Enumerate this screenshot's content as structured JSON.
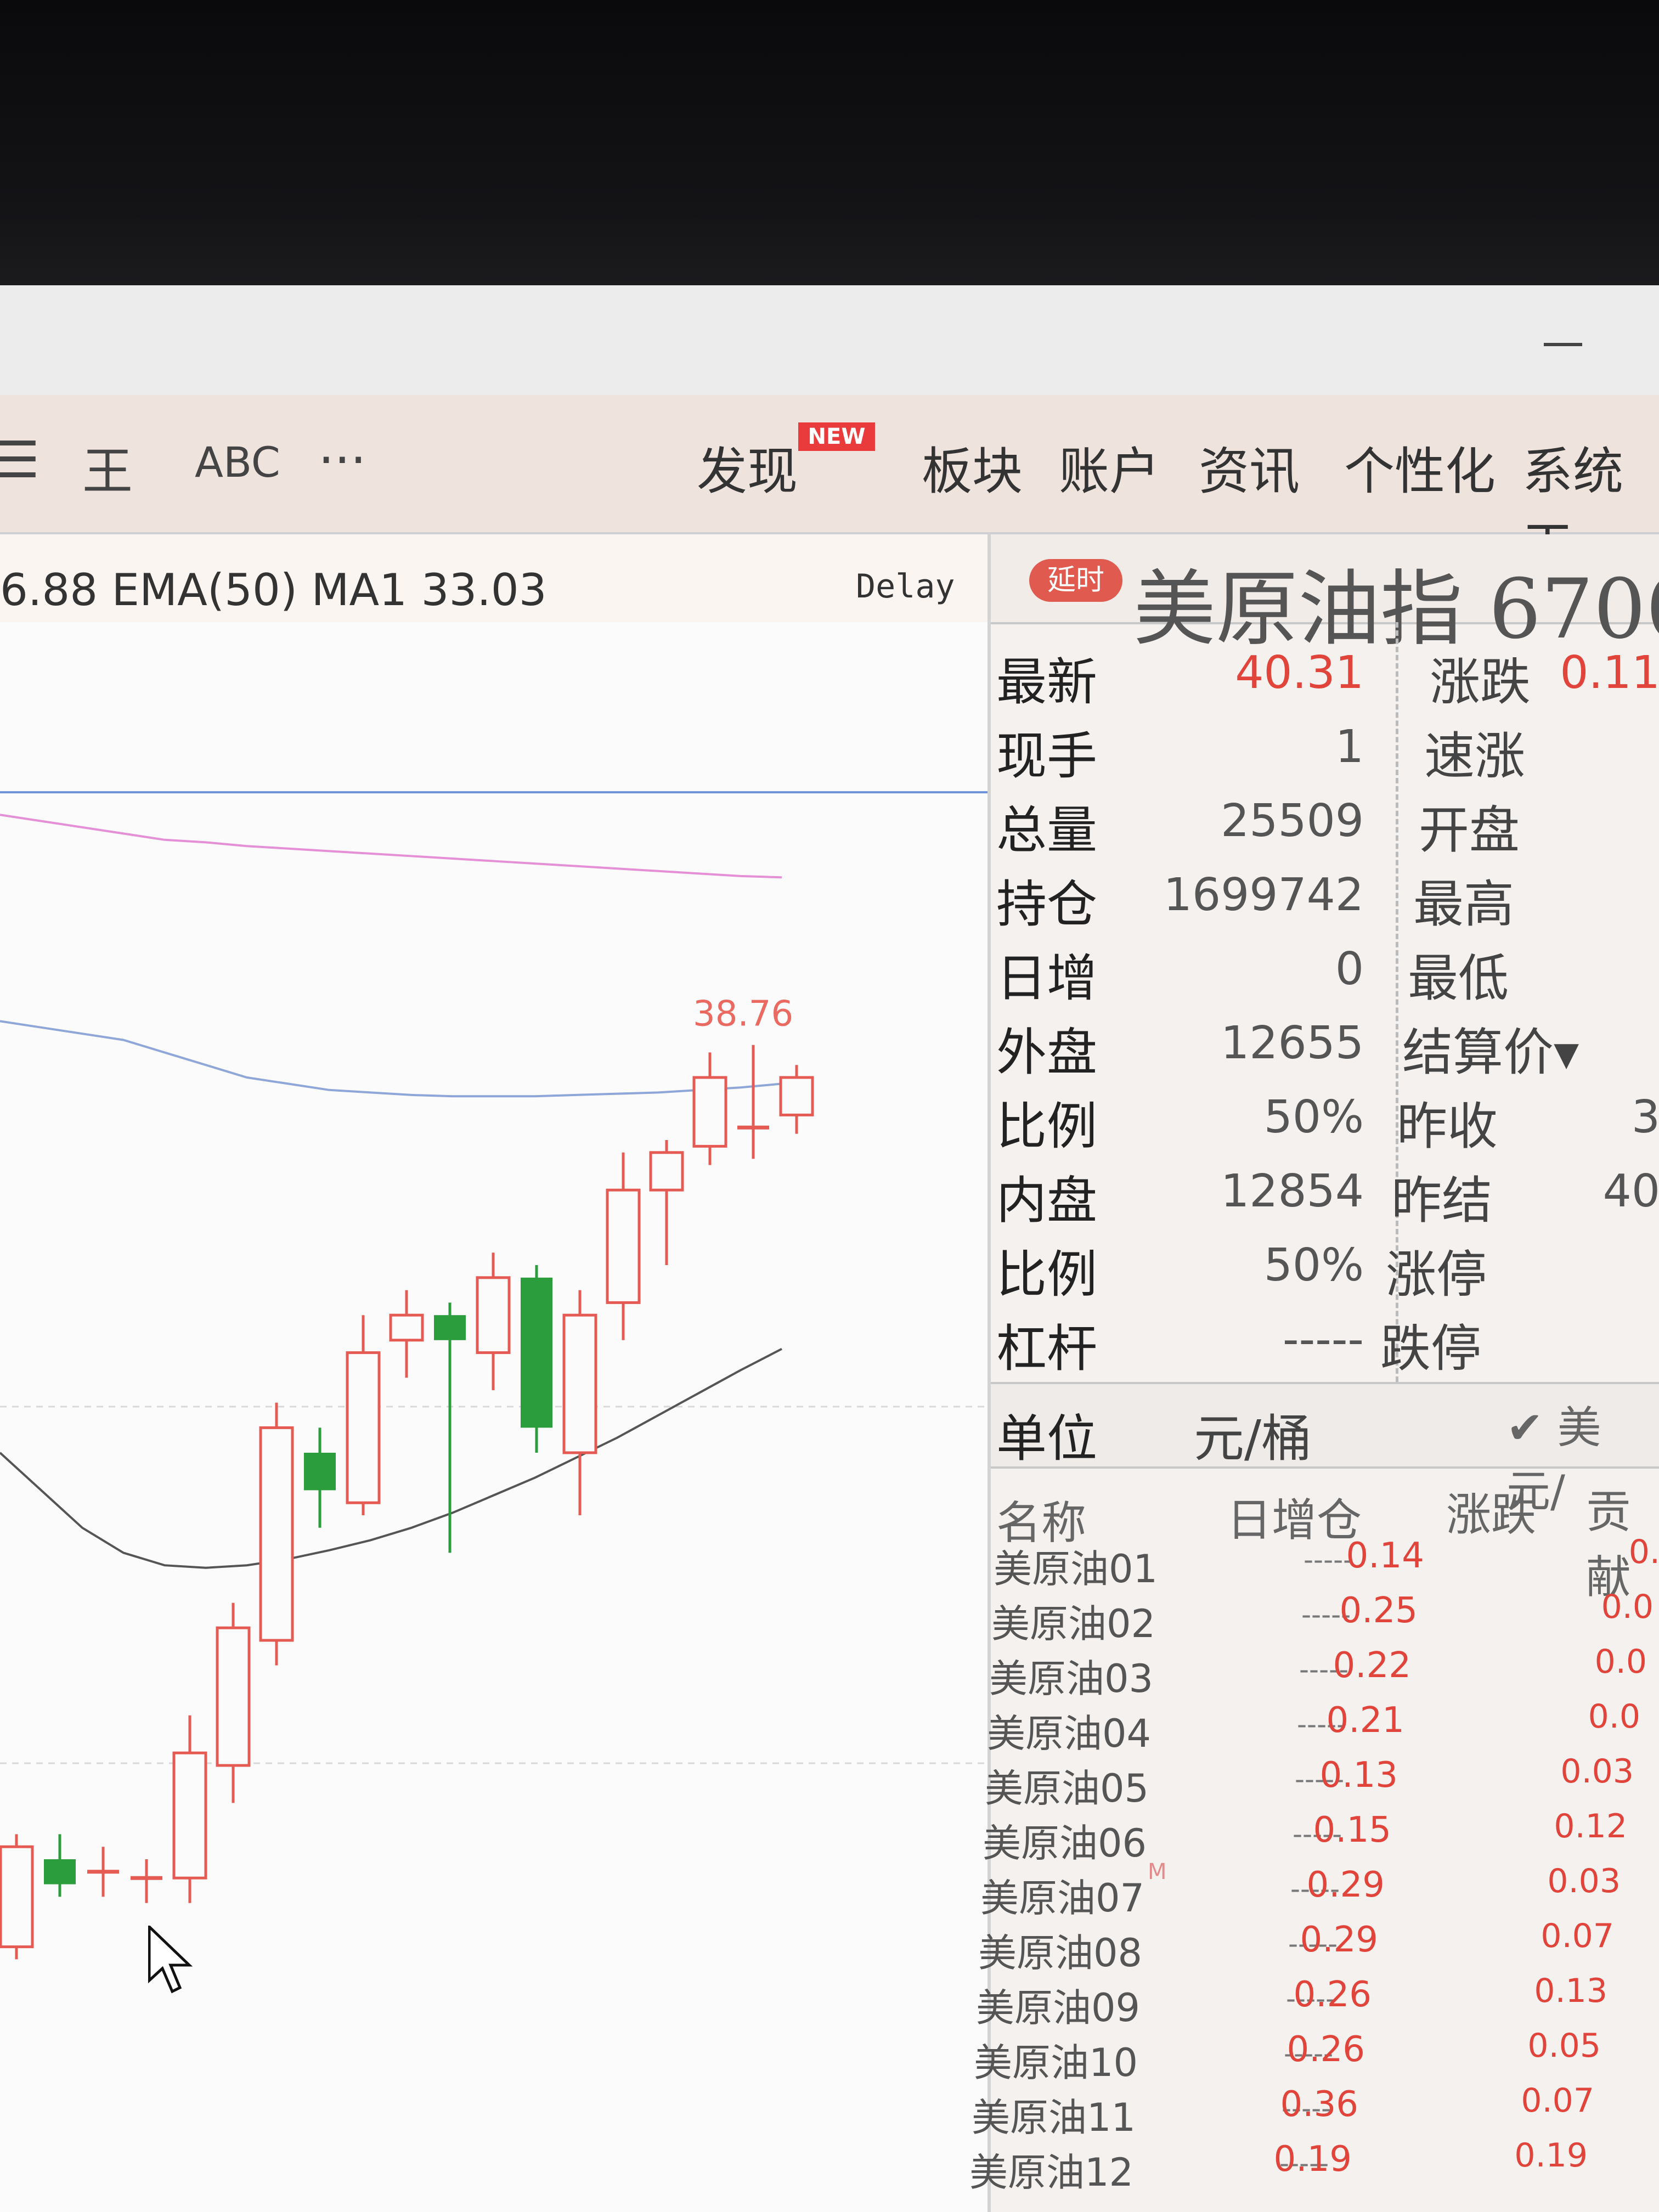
{
  "toolbar": {
    "tools": [
      "☰",
      "王",
      "ABC",
      "···"
    ],
    "menus": [
      "发现",
      "板块",
      "账户",
      "资讯",
      "个性化",
      "系统工"
    ],
    "new_badge": "NEW"
  },
  "chart_header": {
    "indicator": "6.88  EMA(50)  MA1 33.03",
    "delay": "Delay"
  },
  "chart_data": {
    "type": "candlestick",
    "annotation": "38.76",
    "candles": [
      {
        "open": 31.55,
        "close": 32.35,
        "high": 32.45,
        "low": 31.45,
        "dir": "up"
      },
      {
        "open": 32.25,
        "close": 32.05,
        "high": 32.45,
        "low": 31.95,
        "dir": "down"
      },
      {
        "open": 32.15,
        "close": 32.15,
        "high": 32.35,
        "low": 31.95,
        "dir": "flat"
      },
      {
        "open": 32.1,
        "close": 32.1,
        "high": 32.25,
        "low": 31.9,
        "dir": "flat"
      },
      {
        "open": 32.1,
        "close": 33.1,
        "high": 33.4,
        "low": 31.9,
        "dir": "up"
      },
      {
        "open": 33.0,
        "close": 34.1,
        "high": 34.3,
        "low": 32.7,
        "dir": "up"
      },
      {
        "open": 34.0,
        "close": 35.7,
        "high": 35.9,
        "low": 33.8,
        "dir": "up"
      },
      {
        "open": 35.5,
        "close": 35.2,
        "high": 35.7,
        "low": 34.9,
        "dir": "down"
      },
      {
        "open": 35.1,
        "close": 36.3,
        "high": 36.6,
        "low": 35.0,
        "dir": "up"
      },
      {
        "open": 36.4,
        "close": 36.6,
        "high": 36.8,
        "low": 36.1,
        "dir": "up"
      },
      {
        "open": 36.6,
        "close": 36.4,
        "high": 36.7,
        "low": 34.7,
        "dir": "down"
      },
      {
        "open": 36.3,
        "close": 36.9,
        "high": 37.1,
        "low": 36.0,
        "dir": "up"
      },
      {
        "open": 36.9,
        "close": 35.7,
        "high": 37.0,
        "low": 35.5,
        "dir": "down"
      },
      {
        "open": 35.5,
        "close": 36.6,
        "high": 36.8,
        "low": 35.0,
        "dir": "up"
      },
      {
        "open": 36.7,
        "close": 37.6,
        "high": 37.9,
        "low": 36.4,
        "dir": "up"
      },
      {
        "open": 37.6,
        "close": 37.9,
        "high": 38.0,
        "low": 37.0,
        "dir": "up"
      },
      {
        "open": 37.95,
        "close": 38.5,
        "high": 38.7,
        "low": 37.8,
        "dir": "up"
      },
      {
        "open": 38.1,
        "close": 38.1,
        "high": 38.76,
        "low": 37.85,
        "dir": "flat"
      },
      {
        "open": 38.2,
        "close": 38.5,
        "high": 38.6,
        "low": 38.05,
        "dir": "up"
      }
    ],
    "lines": [
      {
        "name": "MA1",
        "color": "#e58fd6",
        "y": [
          40.6,
          40.55,
          40.5,
          40.45,
          40.4,
          40.38,
          40.35,
          40.33,
          40.31,
          40.29,
          40.27,
          40.25,
          40.23,
          40.21,
          40.19,
          40.17,
          40.15,
          40.13,
          40.11,
          40.1
        ]
      },
      {
        "name": "EMA(50)",
        "color": "#8fa6d8",
        "y": [
          38.95,
          38.9,
          38.85,
          38.8,
          38.7,
          38.6,
          38.5,
          38.45,
          38.4,
          38.38,
          38.36,
          38.35,
          38.35,
          38.35,
          38.36,
          38.37,
          38.38,
          38.4,
          38.42,
          38.45
        ]
      },
      {
        "name": "line3",
        "color": "#555555",
        "y": [
          35.5,
          35.2,
          34.9,
          34.7,
          34.6,
          34.58,
          34.6,
          34.65,
          34.72,
          34.8,
          34.9,
          35.02,
          35.16,
          35.3,
          35.46,
          35.62,
          35.8,
          35.98,
          36.16,
          36.33
        ]
      }
    ],
    "hline": {
      "color": "#6f93d8",
      "value": 40.78
    }
  },
  "quote": {
    "badge": "延时",
    "title": "美原油指  6700",
    "left_stats": [
      {
        "label": "最新",
        "value": "40.31",
        "red": true
      },
      {
        "label": "现手",
        "value": "1",
        "red": false
      },
      {
        "label": "总量",
        "value": "25509",
        "red": false
      },
      {
        "label": "持仓",
        "value": "1699742",
        "red": false
      },
      {
        "label": "日增",
        "value": "0",
        "red": false
      },
      {
        "label": "外盘",
        "value": "12655",
        "red": false
      },
      {
        "label": "比例",
        "value": "50%",
        "red": false
      },
      {
        "label": "内盘",
        "value": "12854",
        "red": false
      },
      {
        "label": "比例",
        "value": "50%",
        "red": false
      },
      {
        "label": "杠杆",
        "value": "-----",
        "red": false
      }
    ],
    "right_stats": [
      {
        "label": "涨跌",
        "value": "0.11"
      },
      {
        "label": "速涨",
        "value": ""
      },
      {
        "label": "开盘",
        "value": ""
      },
      {
        "label": "最高",
        "value": ""
      },
      {
        "label": "最低",
        "value": ""
      },
      {
        "label": "结算价▾",
        "value": ""
      },
      {
        "label": "昨收",
        "value": "3"
      },
      {
        "label": "昨结",
        "value": "40"
      },
      {
        "label": "涨停",
        "value": ""
      },
      {
        "label": "跌停",
        "value": ""
      }
    ],
    "unit_label": "单位",
    "unit_value": "元/桶",
    "unit_alt": "✔ 美元/"
  },
  "contracts_table": {
    "headers": [
      "名称",
      "日增仓",
      "涨跌",
      "贡献"
    ],
    "rows": [
      {
        "name": "美原油01",
        "inc": "-----",
        "chg": "0.14",
        "contrib": "0."
      },
      {
        "name": "美原油02",
        "inc": "-----",
        "chg": "0.25",
        "contrib": "0.0"
      },
      {
        "name": "美原油03",
        "inc": "-----",
        "chg": "0.22",
        "contrib": "0.0"
      },
      {
        "name": "美原油04",
        "inc": "-----",
        "chg": "0.21",
        "contrib": "0.0"
      },
      {
        "name": "美原油05",
        "inc": "-----",
        "chg": "0.13",
        "contrib": "0.03"
      },
      {
        "name": "美原油06",
        "inc": "-----",
        "chg": "0.15",
        "contrib": "0.12"
      },
      {
        "name": "美原油07",
        "inc": "-----",
        "chg": "0.29",
        "contrib": "0.03",
        "mark": "M"
      },
      {
        "name": "美原油08",
        "inc": "-----",
        "chg": "0.29",
        "contrib": "0.07"
      },
      {
        "name": "美原油09",
        "inc": "-----",
        "chg": "0.26",
        "contrib": "0.13"
      },
      {
        "name": "美原油10",
        "inc": "-----",
        "chg": "0.26",
        "contrib": "0.05"
      },
      {
        "name": "美原油11",
        "inc": "-----",
        "chg": "0.36",
        "contrib": "0.07"
      },
      {
        "name": "美原油12",
        "inc": "-----",
        "chg": "0.19",
        "contrib": "0.19"
      }
    ]
  },
  "colors": {
    "up": "#e65a54",
    "down": "#2c9d3c",
    "accent": "#e0443a"
  }
}
